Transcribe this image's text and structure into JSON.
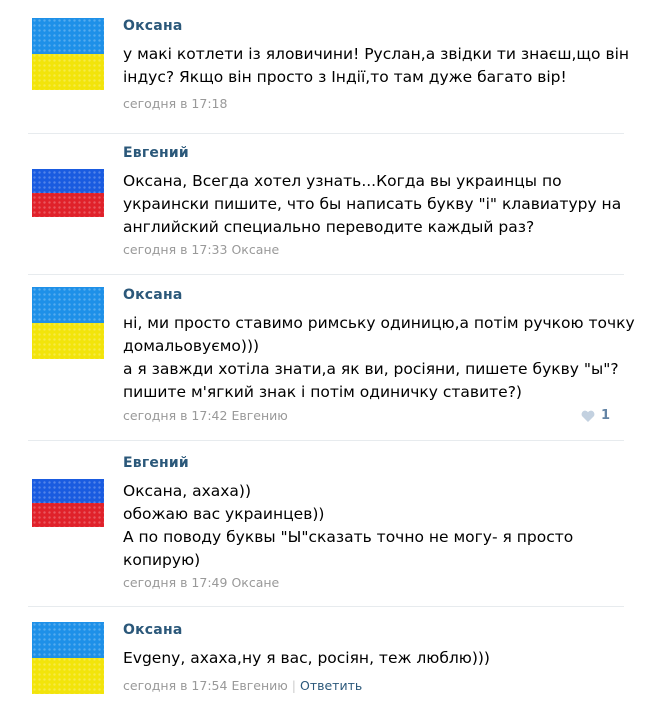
{
  "colors": {
    "author": "#2b587a",
    "meta": "#999999",
    "divider": "#e7ebee",
    "ua_blue": "#1e90e8",
    "ua_yellow": "#f2e40b",
    "ru_white": "#ffffff",
    "ru_blue": "#1a5be0",
    "ru_red": "#e0212a"
  },
  "comments": [
    {
      "author": "Оксана",
      "avatar": "ukraine-flag-avatar",
      "lines": [
        "у макі котлети із яловичини! Руслан,а звідки ти знаєш,що він",
        "індус? Якщо він просто з Індії,то там дуже багато вір!"
      ],
      "time": "сегодня в 17:18"
    },
    {
      "author": "Евгений",
      "avatar": "russia-flag-avatar",
      "lines": [
        "Оксана, Всегда хотел узнать...Когда вы украинцы по",
        "украински пишите, что бы написать букву \"і\" клавиатуру на",
        "английский специально переводите каждый раз?"
      ],
      "time": "сегодня в 17:33",
      "reply_to": "Оксане"
    },
    {
      "author": "Оксана",
      "avatar": "ukraine-flag-avatar",
      "lines": [
        "ні, ми просто ставимо римську одиницю,а потім ручкою точку",
        "домальовуємо)))",
        "а я завжди хотіла знати,а як ви, росіяни, пишете букву \"ы\"?",
        "пишите м'ягкий знак і потім одиничку ставите?)"
      ],
      "time": "сегодня в 17:42",
      "reply_to": "Евгению",
      "likes": "1"
    },
    {
      "author": "Евгений",
      "avatar": "russia-flag-avatar",
      "lines": [
        "Оксана, ахаха))",
        "обожаю вас украинцев))",
        "А по поводу буквы \"Ы\"сказать точно не могу- я просто",
        "копирую)"
      ],
      "time": "сегодня в 17:49",
      "reply_to": "Оксане"
    },
    {
      "author": "Оксана",
      "avatar": "ukraine-flag-avatar",
      "lines": [
        "Evgeny, ахаха,ну я вас, росіян, теж люблю)))"
      ],
      "time": "сегодня в 17:54",
      "reply_to": "Евгению",
      "reply_action": "Ответить"
    }
  ]
}
